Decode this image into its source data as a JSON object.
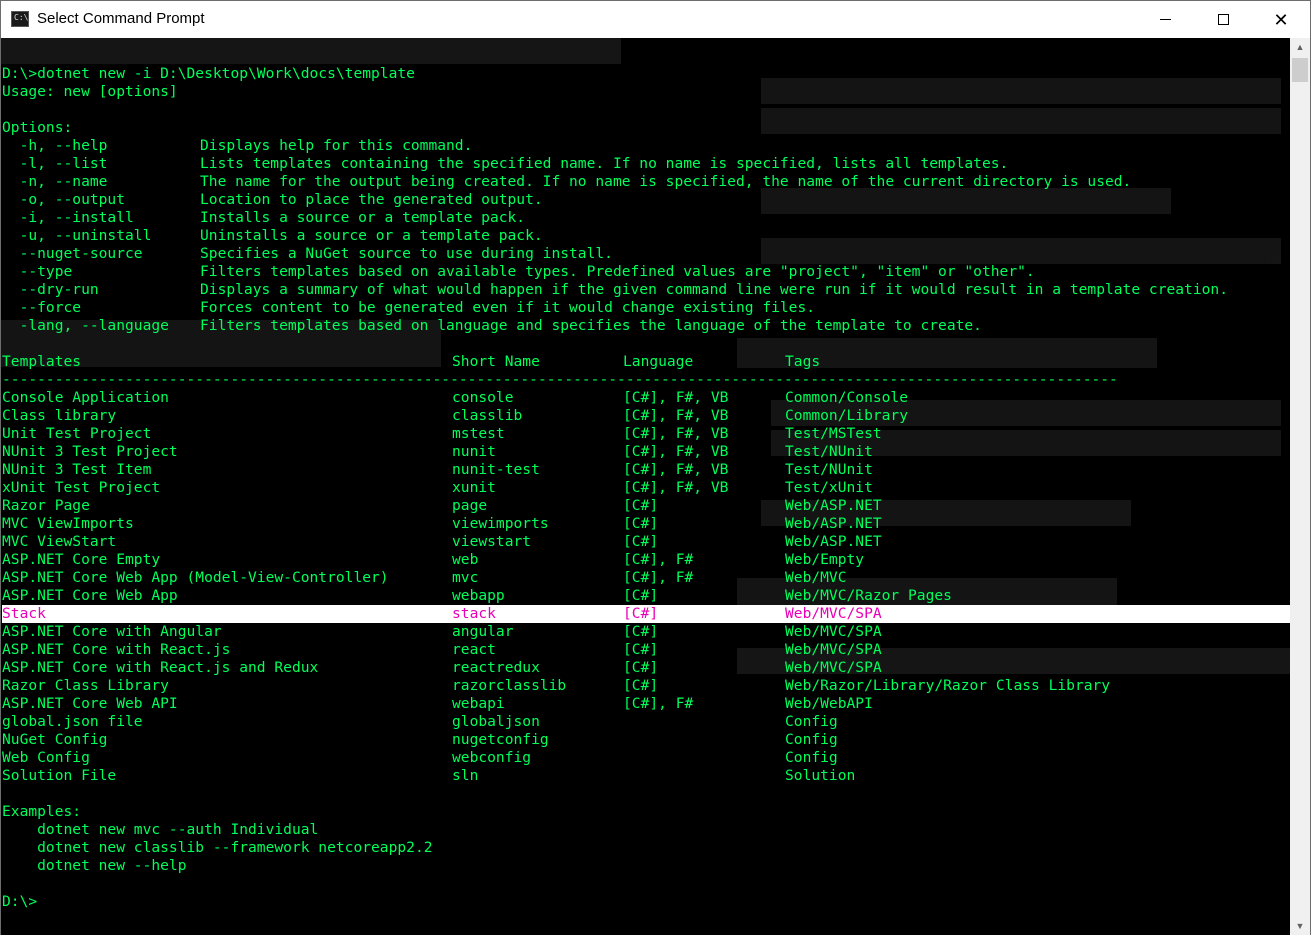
{
  "window": {
    "title": "Select Command Prompt",
    "icon_text": "C:\\",
    "minimize_label": "Minimize",
    "maximize_label": "Maximize",
    "close_glyph": "✕"
  },
  "colors": {
    "terminal_bg": "#000000",
    "terminal_fg": "#00ff5a",
    "selection_bg": "#ffffff",
    "selection_fg": "#e800b8"
  },
  "terminal": {
    "command": "D:\\>dotnet new -i D:\\Desktop\\Work\\docs\\template",
    "usage": "Usage: new [options]",
    "blank_1": "",
    "options_header": "Options:",
    "options": [
      {
        "flag": "  -h, --help",
        "desc": "Displays help for this command."
      },
      {
        "flag": "  -l, --list",
        "desc": "Lists templates containing the specified name. If no name is specified, lists all templates."
      },
      {
        "flag": "  -n, --name",
        "desc": "The name for the output being created. If no name is specified, the name of the current directory is used."
      },
      {
        "flag": "  -o, --output",
        "desc": "Location to place the generated output."
      },
      {
        "flag": "  -i, --install",
        "desc": "Installs a source or a template pack."
      },
      {
        "flag": "  -u, --uninstall",
        "desc": "Uninstalls a source or a template pack."
      },
      {
        "flag": "  --nuget-source",
        "desc": "Specifies a NuGet source to use during install."
      },
      {
        "flag": "  --type",
        "desc": "Filters templates based on available types. Predefined values are \"project\", \"item\" or \"other\"."
      },
      {
        "flag": "  --dry-run",
        "desc": "Displays a summary of what would happen if the given command line were run if it would result in a template creation."
      },
      {
        "flag": "  --force",
        "desc": "Forces content to be generated even if it would change existing files."
      },
      {
        "flag": "  -lang, --language",
        "desc": "Filters templates based on language and specifies the language of the template to create."
      }
    ],
    "blank_2": "",
    "table_header": {
      "templates": "Templates",
      "short_name": "Short Name",
      "language": "Language",
      "tags": "Tags"
    },
    "separator": "--------------------------------------------------------------------------------------------------------------------------------------------------------------",
    "rows": [
      {
        "template": "Console Application",
        "short": "console",
        "lang": "[C#], F#, VB",
        "tags": "Common/Console"
      },
      {
        "template": "Class library",
        "short": "classlib",
        "lang": "[C#], F#, VB",
        "tags": "Common/Library"
      },
      {
        "template": "Unit Test Project",
        "short": "mstest",
        "lang": "[C#], F#, VB",
        "tags": "Test/MSTest"
      },
      {
        "template": "NUnit 3 Test Project",
        "short": "nunit",
        "lang": "[C#], F#, VB",
        "tags": "Test/NUnit"
      },
      {
        "template": "NUnit 3 Test Item",
        "short": "nunit-test",
        "lang": "[C#], F#, VB",
        "tags": "Test/NUnit"
      },
      {
        "template": "xUnit Test Project",
        "short": "xunit",
        "lang": "[C#], F#, VB",
        "tags": "Test/xUnit"
      },
      {
        "template": "Razor Page",
        "short": "page",
        "lang": "[C#]",
        "tags": "Web/ASP.NET"
      },
      {
        "template": "MVC ViewImports",
        "short": "viewimports",
        "lang": "[C#]",
        "tags": "Web/ASP.NET"
      },
      {
        "template": "MVC ViewStart",
        "short": "viewstart",
        "lang": "[C#]",
        "tags": "Web/ASP.NET"
      },
      {
        "template": "ASP.NET Core Empty",
        "short": "web",
        "lang": "[C#], F#",
        "tags": "Web/Empty"
      },
      {
        "template": "ASP.NET Core Web App (Model-View-Controller)",
        "short": "mvc",
        "lang": "[C#], F#",
        "tags": "Web/MVC"
      },
      {
        "template": "ASP.NET Core Web App",
        "short": "webapp",
        "lang": "[C#]",
        "tags": "Web/MVC/Razor Pages"
      },
      {
        "template": "Stack",
        "short": "stack",
        "lang": "[C#]",
        "tags": "Web/MVC/SPA",
        "selected": true
      },
      {
        "template": "ASP.NET Core with Angular",
        "short": "angular",
        "lang": "[C#]",
        "tags": "Web/MVC/SPA"
      },
      {
        "template": "ASP.NET Core with React.js",
        "short": "react",
        "lang": "[C#]",
        "tags": "Web/MVC/SPA"
      },
      {
        "template": "ASP.NET Core with React.js and Redux",
        "short": "reactredux",
        "lang": "[C#]",
        "tags": "Web/MVC/SPA"
      },
      {
        "template": "Razor Class Library",
        "short": "razorclasslib",
        "lang": "[C#]",
        "tags": "Web/Razor/Library/Razor Class Library"
      },
      {
        "template": "ASP.NET Core Web API",
        "short": "webapi",
        "lang": "[C#], F#",
        "tags": "Web/WebAPI"
      },
      {
        "template": "global.json file",
        "short": "globaljson",
        "lang": "",
        "tags": "Config"
      },
      {
        "template": "NuGet Config",
        "short": "nugetconfig",
        "lang": "",
        "tags": "Config"
      },
      {
        "template": "Web Config",
        "short": "webconfig",
        "lang": "",
        "tags": "Config"
      },
      {
        "template": "Solution File",
        "short": "sln",
        "lang": "",
        "tags": "Solution"
      }
    ],
    "blank_3": "",
    "examples_header": "Examples:",
    "examples": [
      "    dotnet new mvc --auth Individual",
      "    dotnet new classlib --framework netcoreapp2.2",
      "    dotnet new --help"
    ],
    "blank_4": "",
    "prompt": "D:\\>"
  },
  "scrollbar": {
    "up_glyph": "▲",
    "down_glyph": "▼"
  }
}
